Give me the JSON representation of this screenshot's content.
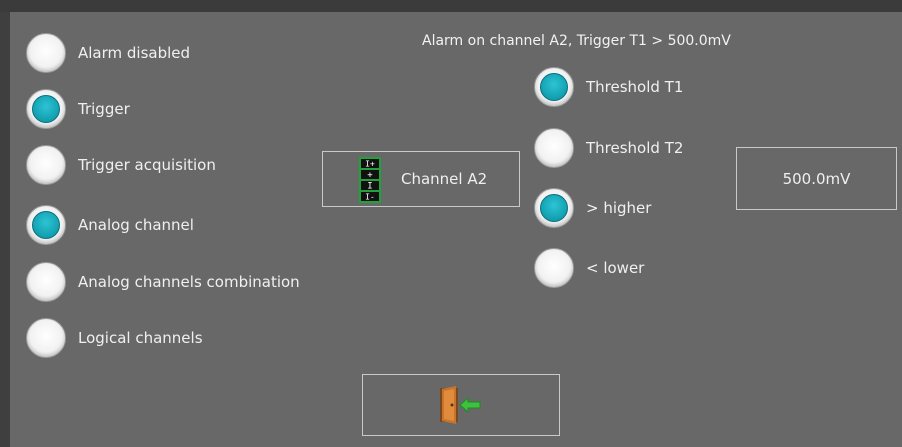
{
  "header": {
    "text": "Alarm on channel A2, Trigger T1 >  500.0mV"
  },
  "left_options": [
    {
      "label": "Alarm disabled",
      "checked": false
    },
    {
      "label": "Trigger",
      "checked": true
    },
    {
      "label": "Trigger acquisition",
      "checked": false
    },
    {
      "label": "Analog channel",
      "checked": true
    },
    {
      "label": "Analog channels combination",
      "checked": false
    },
    {
      "label": "Logical channels",
      "checked": false
    }
  ],
  "channel_button": {
    "label": "Channel A2",
    "icon": "channel-connector-icon"
  },
  "threshold_options": [
    {
      "label": "Threshold T1",
      "checked": true
    },
    {
      "label": "Threshold T2",
      "checked": false
    }
  ],
  "compare_options": [
    {
      "label": "> higher",
      "checked": true
    },
    {
      "label": "< lower",
      "checked": false
    }
  ],
  "threshold_value": "500.0mV",
  "exit_button": {
    "icon": "exit-door-icon"
  },
  "colors": {
    "accent": "#17a8b8",
    "panel": "#686868",
    "border": "#c9c9c9"
  }
}
